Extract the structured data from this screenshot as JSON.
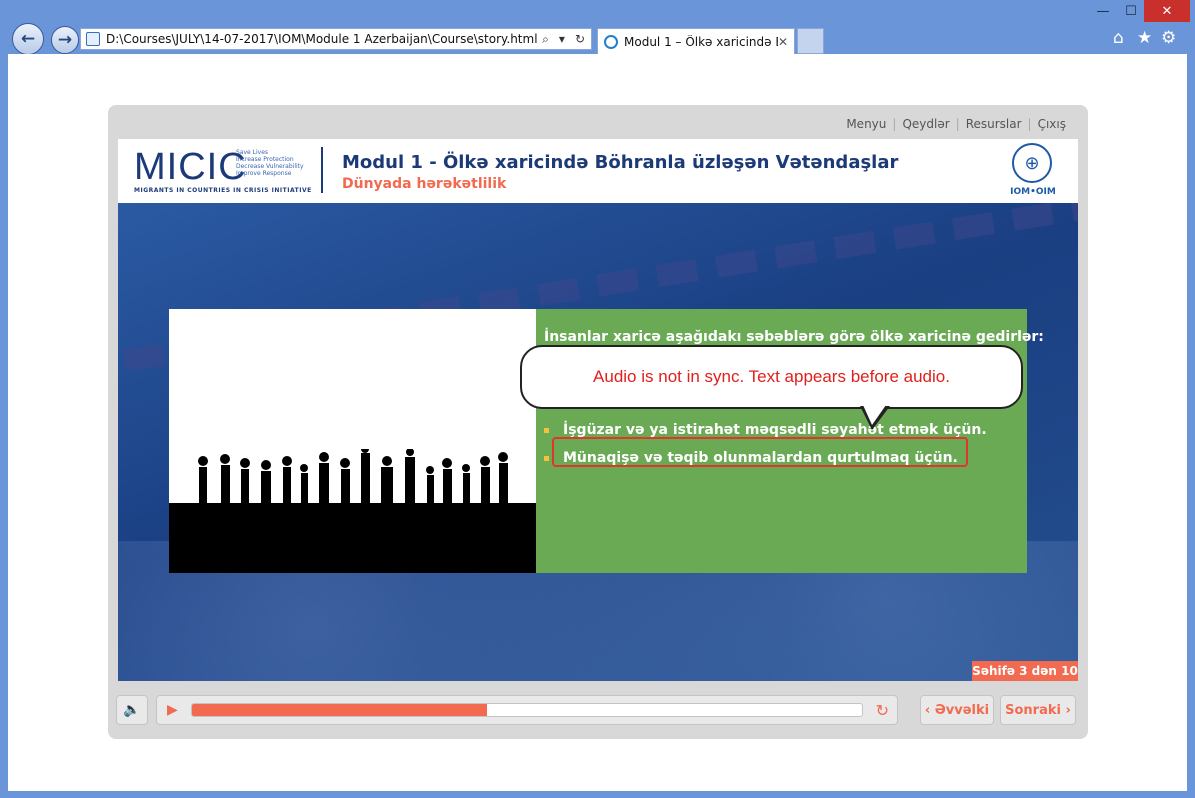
{
  "browser": {
    "address_url": "D:\\Courses\\JULY\\14-07-2017\\IOM\\Module 1 Azerbaijan\\Course\\story.html",
    "tab_title": "Modul 1 – Ölkə xaricində B...",
    "window_controls": {
      "minimize": "—",
      "maximize": "☐",
      "close": "✕"
    },
    "icons": {
      "back": "back-arrow-icon",
      "forward": "forward-arrow-icon",
      "search": "search-icon",
      "refresh": "refresh-icon",
      "home": "home-icon",
      "favorites": "star-icon",
      "settings": "gear-icon"
    }
  },
  "player": {
    "menu": [
      "Menyu",
      "Qeydlər",
      "Resurslar",
      "Çıxış"
    ],
    "header": {
      "logo_text": "MICIC",
      "logo_tagline": [
        "Save Lives",
        "Increase Protection",
        "Decrease Vulnerability",
        "Improve Response"
      ],
      "logo_subtitle": "MIGRANTS IN COUNTRIES IN CRISIS INITIATIVE",
      "title": "Modul 1 - Ölkə xaricində Böhranla üzləşən Vətəndaşlar",
      "subtitle": "Dünyada hərəkətlilik",
      "org_logo_text": "IOM•OIM"
    },
    "slide": {
      "heading": "İnsanlar xaricə aşağıdakı səbəblərə görə ölkə xaricinə gedirlər:",
      "bullets": [
        "İşgüzar və ya istirahət məqsədli səyahət etmək üçün.",
        "Münaqişə və təqib olunmalardan qurtulmaq üçün."
      ],
      "callout": "Audio is not in sync. Text appears before audio.",
      "page_indicator": "Səhifə 3 dən 10"
    },
    "controls": {
      "progress_fraction": 0.44,
      "prev_label": "Əvvəlki",
      "next_label": "Sonraki"
    }
  },
  "colors": {
    "accent": "#f26a4f",
    "brand_blue": "#1c3a78",
    "green_panel": "#6aaa55",
    "highlight_red": "#e0362c"
  }
}
